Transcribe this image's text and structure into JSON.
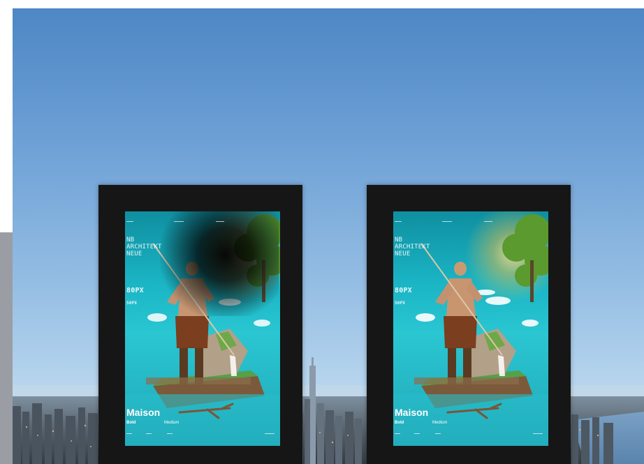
{
  "posters": [
    {
      "title_lines": [
        "NB",
        "ARCHITEKT",
        "NEUE"
      ],
      "size_large": "80PX",
      "size_small": "50PX",
      "brand": "Maison",
      "weight_bold": "Bold",
      "weight_medium": "Medium",
      "has_dark_blob": true
    },
    {
      "title_lines": [
        "NB",
        "ARCHITEKT",
        "NEUE"
      ],
      "size_large": "80PX",
      "size_small": "50PX",
      "brand": "Maison",
      "weight_bold": "Bold",
      "weight_medium": "Medium",
      "has_dark_blob": false
    }
  ],
  "colors": {
    "sky_top": "#4d87c5",
    "sky_bottom": "#c7dff1",
    "frame": "#161616",
    "poster_teal": "#1ab4c4"
  }
}
